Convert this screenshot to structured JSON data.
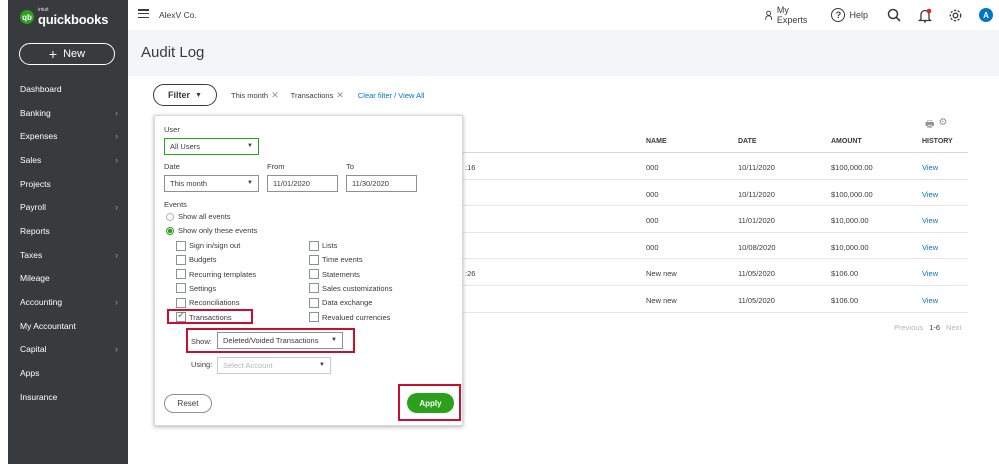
{
  "brand": {
    "badge": "qb",
    "small": "intuit",
    "name": "quickbooks"
  },
  "sidebar": {
    "new_label": "New",
    "items": [
      {
        "label": "Dashboard",
        "chevron": false
      },
      {
        "label": "Banking",
        "chevron": true
      },
      {
        "label": "Expenses",
        "chevron": true
      },
      {
        "label": "Sales",
        "chevron": true
      },
      {
        "label": "Projects",
        "chevron": false
      },
      {
        "label": "Payroll",
        "chevron": true
      },
      {
        "label": "Reports",
        "chevron": false
      },
      {
        "label": "Taxes",
        "chevron": true
      },
      {
        "label": "Mileage",
        "chevron": false
      },
      {
        "label": "Accounting",
        "chevron": true
      },
      {
        "label": "My Accountant",
        "chevron": false
      },
      {
        "label": "Capital",
        "chevron": true
      },
      {
        "label": "Apps",
        "chevron": false
      },
      {
        "label": "Insurance",
        "chevron": false
      }
    ]
  },
  "topbar": {
    "company": "AlexV Co.",
    "my_experts": "My Experts",
    "help": "Help",
    "avatar_letter": "A"
  },
  "page": {
    "title": "Audit Log"
  },
  "filter_bar": {
    "filter_label": "Filter",
    "chips": [
      "This month",
      "Transactions"
    ],
    "clear_link": "Clear filter / View All"
  },
  "filter_panel": {
    "user_label": "User",
    "user_value": "All Users",
    "date_label": "Date",
    "date_value": "This month",
    "from_label": "From",
    "from_value": "11/01/2020",
    "to_label": "To",
    "to_value": "11/30/2020",
    "events_label": "Events",
    "show_all": "Show all events",
    "show_only": "Show only these events",
    "checkboxes_left": [
      {
        "label": "Sign in/sign out",
        "checked": false
      },
      {
        "label": "Budgets",
        "checked": false
      },
      {
        "label": "Recurring templates",
        "checked": false
      },
      {
        "label": "Settings",
        "checked": false
      },
      {
        "label": "Reconciliations",
        "checked": false
      },
      {
        "label": "Transactions",
        "checked": true
      }
    ],
    "checkboxes_right": [
      {
        "label": "Lists",
        "checked": false
      },
      {
        "label": "Time events",
        "checked": false
      },
      {
        "label": "Statements",
        "checked": false
      },
      {
        "label": "Sales customizations",
        "checked": false
      },
      {
        "label": "Data exchange",
        "checked": false
      },
      {
        "label": "Revalued currencies",
        "checked": false
      }
    ],
    "show_label": "Show:",
    "show_value": "Deleted/Voided Transactions",
    "using_label": "Using:",
    "using_placeholder": "Select Account",
    "cancel_label": "Reset",
    "apply_label": "Apply"
  },
  "table": {
    "columns": [
      "NAME",
      "DATE",
      "AMOUNT",
      "HISTORY"
    ],
    "rows": [
      {
        "partial": ":16",
        "name": "000",
        "date": "10/11/2020",
        "amount": "$100,000.00",
        "history": "View"
      },
      {
        "partial": "",
        "name": "000",
        "date": "10/11/2020",
        "amount": "$100,000.00",
        "history": "View"
      },
      {
        "partial": "",
        "name": "000",
        "date": "11/01/2020",
        "amount": "$10,000.00",
        "history": "View"
      },
      {
        "partial": "",
        "name": "000",
        "date": "10/08/2020",
        "amount": "$10,000.00",
        "history": "View"
      },
      {
        "partial": ":26",
        "name": "New new",
        "date": "11/05/2020",
        "amount": "$106.00",
        "history": "View"
      },
      {
        "partial": "",
        "name": "New new",
        "date": "11/05/2020",
        "amount": "$106.00",
        "history": "View"
      }
    ],
    "pager": {
      "previous": "Previous",
      "range": "1-6",
      "next": "Next"
    }
  }
}
